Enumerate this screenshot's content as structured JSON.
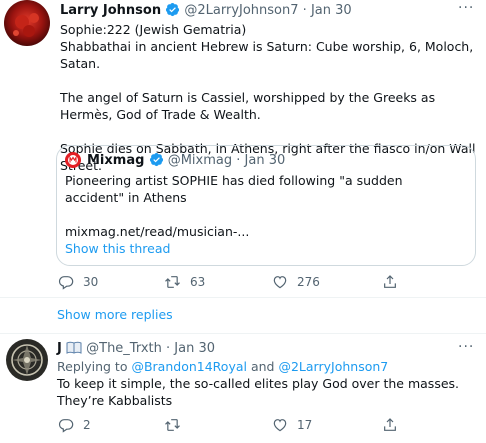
{
  "tweet1": {
    "name": "Larry Johnson",
    "handle": "@2LarryJohnson7",
    "separator": "·",
    "date": "Jan 30",
    "lines": [
      "Sophie:222 (Jewish Gematria)",
      "Shabbathai in ancient Hebrew is Saturn: Cube worship, 6, Moloch, Satan.",
      "The angel of Saturn is Cassiel, worshipped by the Greeks as Hermès, God of Trade & Wealth.",
      "Sophie dies on Sabbath, in Athens, right after the fiasco in/on Wall Street."
    ],
    "quote": {
      "name": "Mixmag",
      "handle": "@Mixmag",
      "date": "Jan 30",
      "text": "Pioneering artist SOPHIE has died following \"a sudden accident\" in Athens",
      "link": "mixmag.net/read/musician-...",
      "show_thread": "Show this thread"
    },
    "replies": "30",
    "retweets": "63",
    "likes": "276"
  },
  "show_more_replies": "Show more replies",
  "tweet2": {
    "name": "J",
    "handle": "@The_Trxth",
    "separator": "·",
    "date": "Jan 30",
    "replying_prefix": "Replying to",
    "replying_to_1": "@Brandon14Royal",
    "replying_and": "and",
    "replying_to_2": "@2LarryJohnson7",
    "text": "To keep it simple, the so-called elites play God over the masses. They’re Kabbalists",
    "replies": "2",
    "retweets": "",
    "likes": "17"
  },
  "colors": {
    "accent": "#1d9bf0",
    "muted": "#536471",
    "text": "#0f1419",
    "divider": "#eff3f4"
  }
}
